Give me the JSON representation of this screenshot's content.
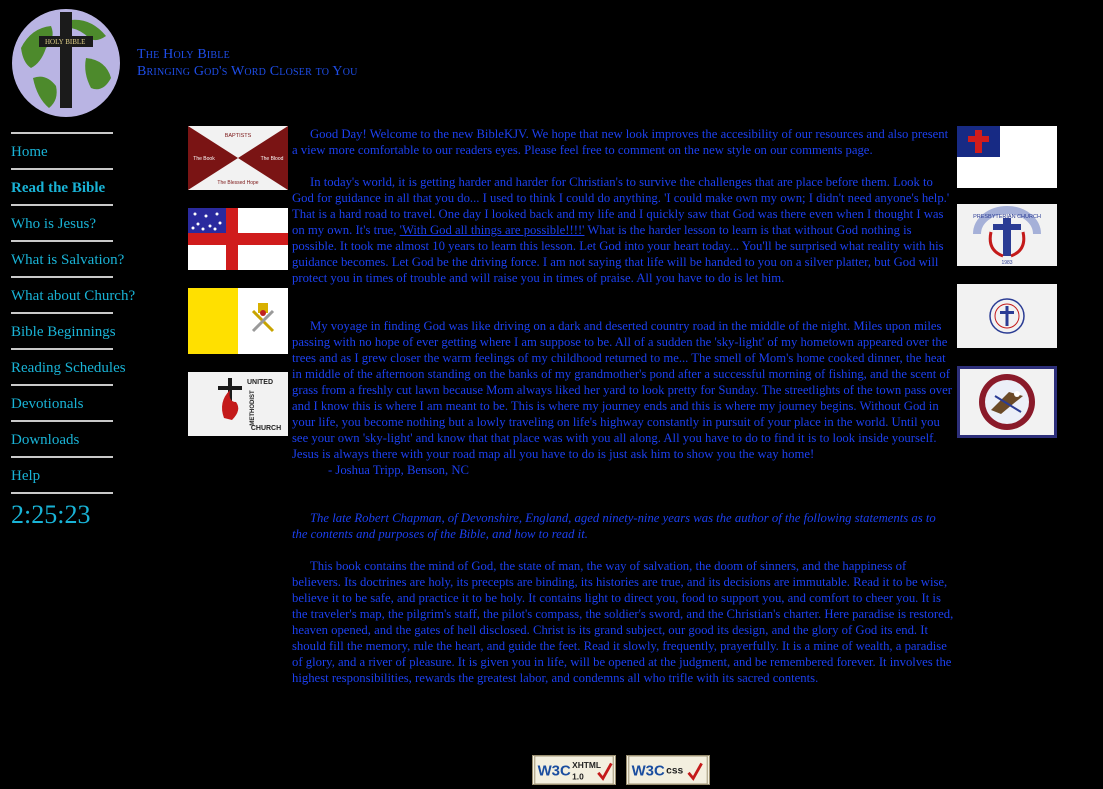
{
  "site": {
    "title_line1": "The Holy Bible",
    "title_line2": "Bringing God's Word Closer to You",
    "logo_text": "HOLY BIBLE"
  },
  "nav": {
    "items": [
      {
        "label": "Home"
      },
      {
        "label": "Read the Bible"
      },
      {
        "label": "Who is Jesus?"
      },
      {
        "label": "What is Salvation?"
      },
      {
        "label": "What about Church?"
      },
      {
        "label": "Bible Beginnings"
      },
      {
        "label": "Reading Schedules"
      },
      {
        "label": "Devotionals"
      },
      {
        "label": "Downloads"
      },
      {
        "label": "Help"
      }
    ],
    "clock": "2:25:23"
  },
  "flags": {
    "baptist": {
      "top": "BAPTISTS",
      "left": "The Book",
      "right": "The Blood",
      "bottom": "The Blessed Hope"
    },
    "methodist": {
      "line1": "UNITED",
      "line2": "METHODIST",
      "line3": "CHURCH"
    },
    "presbyterian": {
      "arc": "PRESBYTERIAN CHURCH",
      "year": "1983"
    }
  },
  "content": {
    "p1_text": "Good Day! Welcome to the new BibleKJV. We hope that new look improves the accesibility of our resources and also present a view more comfortable to our readers eyes. Please feel free to comment on the new style on our ",
    "p1_link": "comments page",
    "p1_end": ".",
    "p2_text": "In today's world, it is getting harder and harder for Christian's to survive the challenges that are place before them. Look to God for guidance in all that you do... I used to think I could do anything. 'I could make own my own; I didn't need anyone's help.' That is a hard road to travel. One day I looked back and my life and I quickly saw that God was there even when I thought I was on my own. It's true, ",
    "p2_link": "'With God all things are possible!!!!'",
    "p2_end": " What is the harder lesson to learn is that without God nothing is possible. It took me almost 10 years to learn this lesson. Let God into your heart today... You'll be surprised what reality with his guidance becomes. Let God be the driving force. I am not saying that life will be handed to you on a silver platter, but God will protect you in times of trouble and will raise you in times of praise. All you have to do is let him.",
    "p3_text": "My voyage in finding God was like driving on a dark and deserted country road in the middle of the night. Miles upon miles passing with no hope of ever getting where I am suppose to be. All of a sudden the 'sky-light' of my hometown appeared over the trees and as I grew closer the warm feelings of my childhood returned to me... The smell of Mom's home cooked dinner, the heat in middle of the afternoon standing on the banks of my grandmother's pond after a successful morning of fishing, and the scent of grass from a freshly cut lawn because Mom always liked her yard to look pretty for Sunday. The streetlights of the town pass over and I know this is where I am meant to be. This is where my journey ends and this is where my journey begins. Without God in your life, you become nothing but a lowly traveling on life's highway constantly in pursuit of your place in the world. Until you see your own 'sky-light' and know that that place was with you all along. All you have to do to find it is to look inside yourself. Jesus is always there with your road map all you have to do is just ask him to show you the way home!",
    "p3_author": "- Joshua Tripp, Benson, NC",
    "p4_italic": "The late Robert Chapman, of Devonshire, England, aged ninety-nine years was the author of the following statements as to the contents and purposes of the Bible, and how to read it.",
    "p5_text": "This book contains the mind of God, the state of man, the way of salvation, the doom of sinners, and the happiness of believers. Its doctrines are holy, its precepts are binding, its histories are true, and its decisions are immutable. Read it to be wise, believe it to be safe, and practice it to be holy. It contains light to direct you, food to support you, and comfort to cheer you. It is the traveler's map, the pilgrim's staff, the pilot's compass, the soldier's sword, and the Christian's charter. Here paradise is restored, heaven opened, and the gates of hell disclosed. Christ is its grand subject, our good its design, and the glory of God its end. It should fill the memory, rule the heart, and guide the feet. Read it slowly, frequently, prayerfully. It is a mine of wealth, a paradise of glory, and a river of pleasure. It is given you in life, will be opened at the judgment, and be remembered forever. It involves the highest responsibilities, rewards the greatest labor, and condemns all who trifle with its sacred contents."
  },
  "badges": {
    "xhtml": {
      "w3c": "W3C",
      "label": "XHTML",
      "version": "1.0"
    },
    "css": {
      "w3c": "W3C",
      "label": "css"
    }
  },
  "colors": {
    "background": "#000000",
    "body_text": "#1c40f0",
    "nav_link": "#19b3d6",
    "nav_separator": "#c9c9c9"
  }
}
